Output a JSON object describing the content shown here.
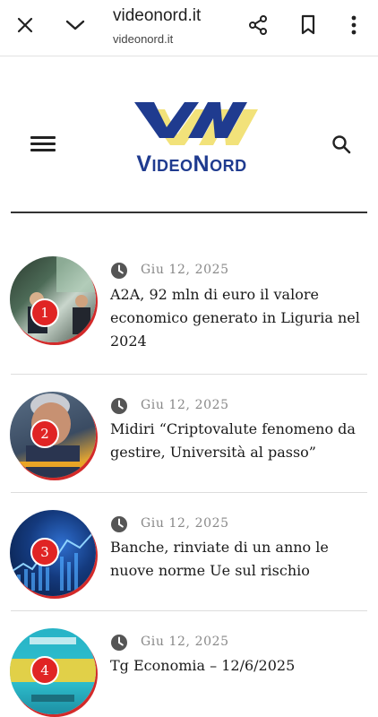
{
  "browser": {
    "title": "videonord.it",
    "url": "videonord.it",
    "icons": [
      "close-icon",
      "chevron-down-icon",
      "share-icon",
      "bookmark-icon",
      "more-vert-icon"
    ]
  },
  "header": {
    "logo_text": "VideoNord",
    "menu_icon": "hamburger-icon",
    "search_icon": "search-icon",
    "colors": {
      "brand_blue": "#1f3b8f",
      "brand_yellow": "#f2e27a",
      "accent_red": "#e02424"
    }
  },
  "articles": [
    {
      "rank": "1",
      "date": "Giu 12, 2025",
      "title": "A2A, 92 mln di euro il valore economico generato in Liguria nel 2024"
    },
    {
      "rank": "2",
      "date": "Giu 12, 2025",
      "title": "Midiri “Criptovalute fenomeno da gestire, Università al passo”"
    },
    {
      "rank": "3",
      "date": "Giu 12, 2025",
      "title": "Banche, rinviate di un anno le nuove norme Ue sul rischio"
    },
    {
      "rank": "4",
      "date": "Giu 12, 2025",
      "title": "Tg Economia – 12/6/2025"
    }
  ]
}
